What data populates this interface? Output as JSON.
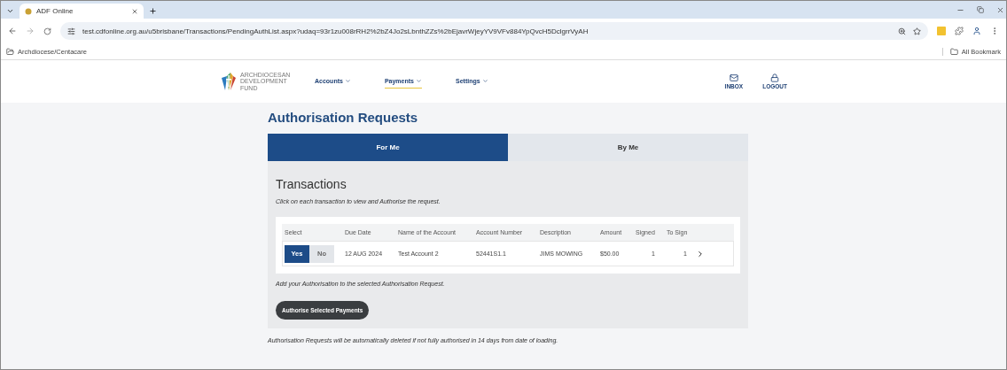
{
  "browser": {
    "tabs": [
      {
        "title": "ADF Online",
        "selected": true
      }
    ],
    "url": "test.cdfonline.org.au/u5brisbane/Transactions/PendingAuthList.aspx?udaq=93r1zu008rRH2%2bZ4Jo2sLbnthZZs%2bEjavrWjeyYV9VFv884YpQvcH5DclgrrVyAH",
    "bookmarks": [
      "Archdiocese/Centacare"
    ],
    "all_bookmarks": "All Bookmark"
  },
  "site": {
    "logo_text": "ARCHDIOCESAN DEVELOPMENT FUND",
    "nav": [
      {
        "label": "Accounts",
        "selected": false
      },
      {
        "label": "Payments",
        "selected": true
      },
      {
        "label": "Settings",
        "selected": false
      }
    ],
    "actions": [
      {
        "kind": "inbox",
        "label": "INBOX"
      },
      {
        "kind": "logout",
        "label": "LOGOUT"
      }
    ]
  },
  "page": {
    "title": "Authorisation Requests",
    "tabs": [
      {
        "label": "For Me",
        "selected": true
      },
      {
        "label": "By Me",
        "selected": false
      }
    ],
    "section_title": "Transactions",
    "hint": "Click on each transaction to view and Authorise the request.",
    "table": {
      "select_column": "Select",
      "columns": [
        "Due Date",
        "Name of the Account",
        "Account Number",
        "Description",
        "Amount",
        "Signed",
        "To Sign"
      ],
      "rows": [
        {
          "choices": [
            {
              "label": "Yes",
              "selected": true
            },
            {
              "label": "No",
              "selected": false
            }
          ],
          "cells": [
            "12 AUG 2024",
            "Test Account 2",
            "52441S1.1",
            "JIMS MOWING",
            "$50.00",
            "1",
            "1"
          ]
        }
      ]
    },
    "add_note": "Add your Authorisation to the selected Authorisation Request.",
    "button": "Authorise Selected Payments",
    "footnote": "Authorisation Requests will be automatically deleted if not fully authorised in 14 days from date of loading."
  }
}
